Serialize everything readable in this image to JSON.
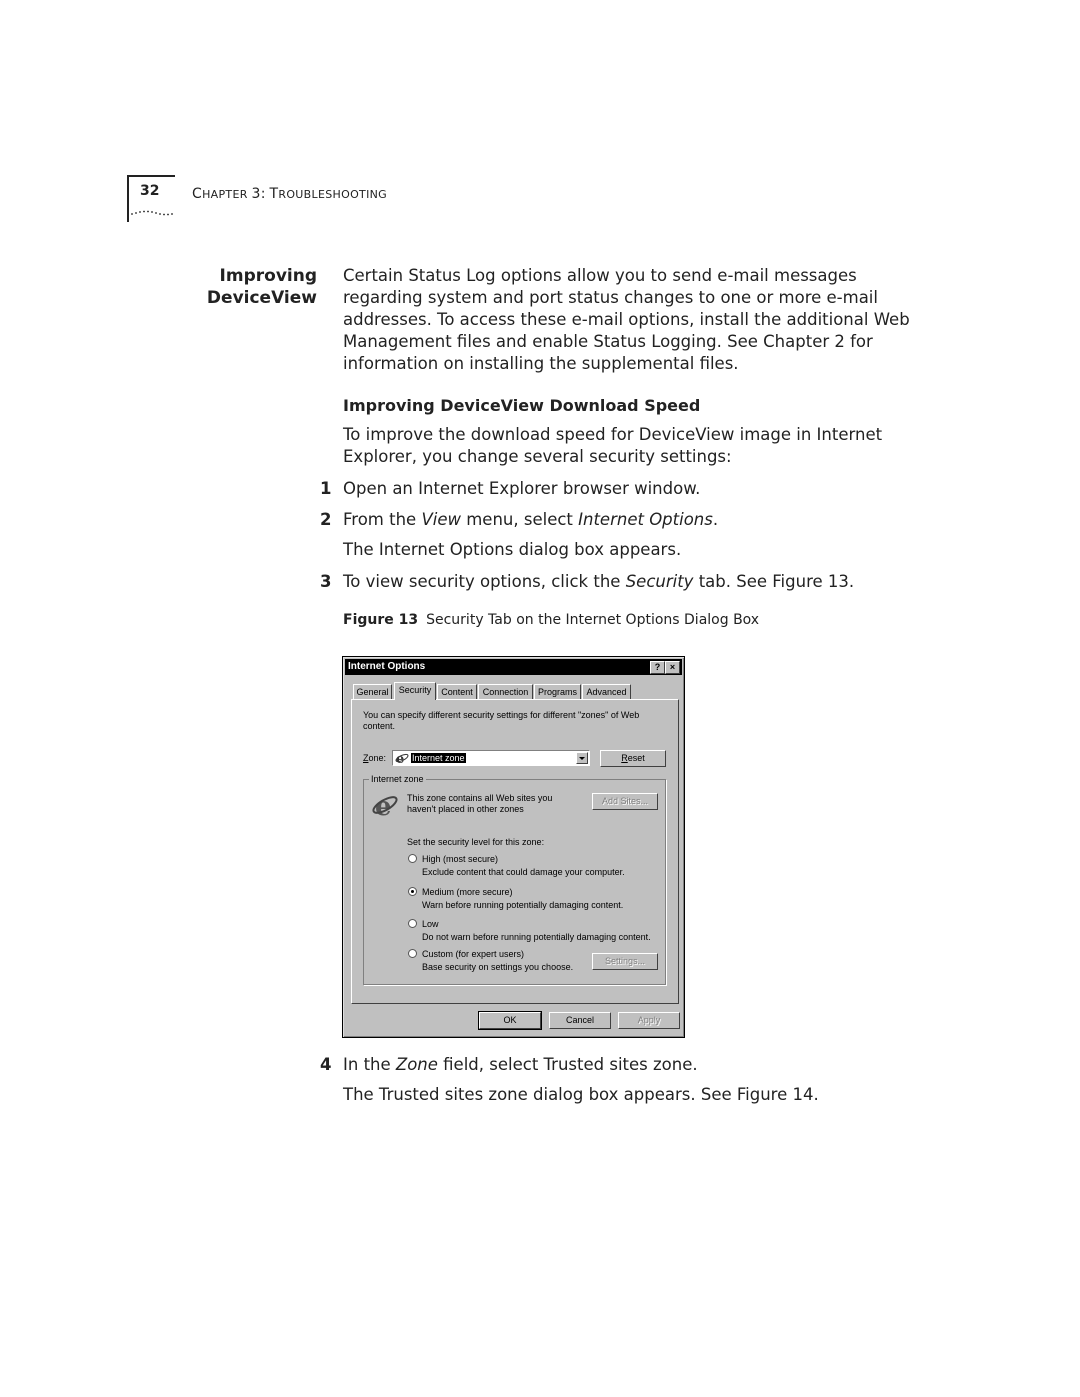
{
  "header": {
    "page_number": "32",
    "chapter_title": "Chapter 3: Troubleshooting"
  },
  "section": {
    "side_heading": [
      "Improving",
      "DeviceView"
    ],
    "intro": "Certain Status Log options allow you to send e-mail messages regarding system and port status changes to one or more e-mail addresses. To access these e-mail options, install the additional Web Management files and enable Status Logging. See Chapter 2 for information on installing the supplemental files.",
    "subheading": "Improving DeviceView Download Speed",
    "lead": "To improve the download speed for DeviceView image in Internet Explorer, you change several security settings:",
    "steps": [
      {
        "num": "1",
        "parts": [
          {
            "t": "Open an Internet Explorer browser window."
          }
        ]
      },
      {
        "num": "2",
        "parts": [
          {
            "t": "From the "
          },
          {
            "t": "View",
            "i": true
          },
          {
            "t": " menu, select "
          },
          {
            "t": "Internet Options",
            "i": true
          },
          {
            "t": "."
          }
        ]
      },
      {
        "num": "3",
        "parts": [
          {
            "t": "To view security options, click the "
          },
          {
            "t": "Security",
            "i": true
          },
          {
            "t": " tab. See Figure 13."
          }
        ]
      },
      {
        "num": "4",
        "parts": [
          {
            "t": "In the "
          },
          {
            "t": "Zone",
            "i": true
          },
          {
            "t": " field, select Trusted sites zone."
          }
        ]
      }
    ],
    "note_after_step2": "The Internet Options dialog box appears.",
    "note_after_step4": "The Trusted sites zone dialog box appears. See Figure 14.",
    "figure_label": "Figure 13",
    "figure_caption": "Security Tab on the Internet Options Dialog Box"
  },
  "dialog": {
    "title": "Internet Options",
    "help_button": "?",
    "close_button": "×",
    "tabs": [
      "General",
      "Security",
      "Content",
      "Connection",
      "Programs",
      "Advanced"
    ],
    "active_tab": "Security",
    "description": "You can specify different security settings for different \"zones\" of Web content.",
    "zone_label": "Zone:",
    "zone_value": "Internet zone",
    "reset_button": "Reset",
    "group_label": "Internet zone",
    "zone_description": [
      "This zone contains all Web sites you",
      "haven't placed in other zones"
    ],
    "add_sites_button": "Add Sites...",
    "level_prompt": "Set the security level for this zone:",
    "levels": [
      {
        "label": "High (most secure)",
        "desc": "Exclude content that could damage your computer.",
        "selected": false
      },
      {
        "label": "Medium (more secure)",
        "desc": "Warn before running potentially damaging content.",
        "selected": true
      },
      {
        "label": "Low",
        "desc": "Do not warn before running potentially damaging content.",
        "selected": false
      },
      {
        "label": "Custom (for expert users)",
        "desc": "Base security on settings you choose.",
        "selected": false
      }
    ],
    "settings_button": "Settings...",
    "ok_button": "OK",
    "cancel_button": "Cancel",
    "apply_button": "Apply"
  }
}
